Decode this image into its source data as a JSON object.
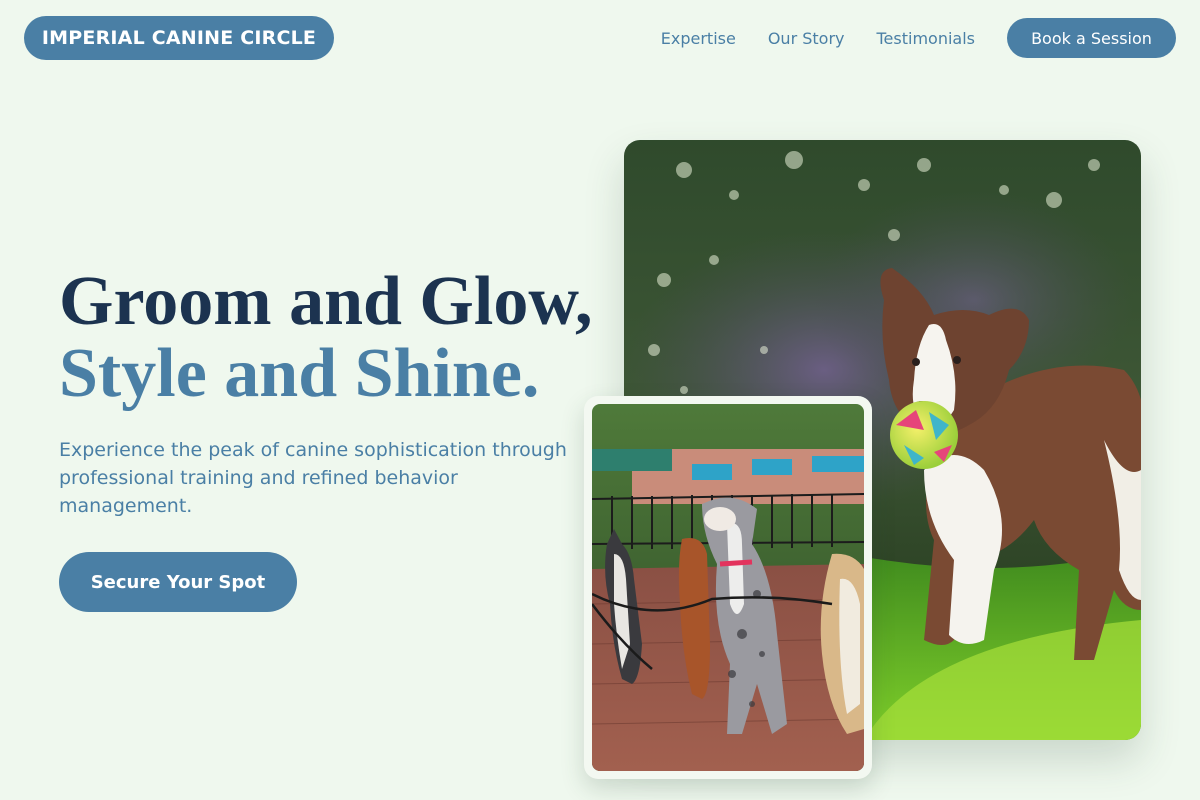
{
  "header": {
    "brand": "IMPERIAL CANINE CIRCLE",
    "nav": [
      "Expertise",
      "Our Story",
      "Testimonials"
    ],
    "cta_label": "Book a Session"
  },
  "hero": {
    "headline_line1": "Groom and Glow,",
    "headline_line2": "Style and Shine.",
    "subtitle": "Experience the peak of canine sophistication through professional training and refined behavior management.",
    "cta_label": "Secure Your Spot"
  },
  "colors": {
    "background": "#eff8ee",
    "accent": "#4a7fa5",
    "headline_dark": "#1c3350"
  },
  "images": {
    "main_photo": "border collie running on grass with a colorful ball",
    "secondary_photo": "group of dogs on leashes sitting on a brick path in a park"
  }
}
